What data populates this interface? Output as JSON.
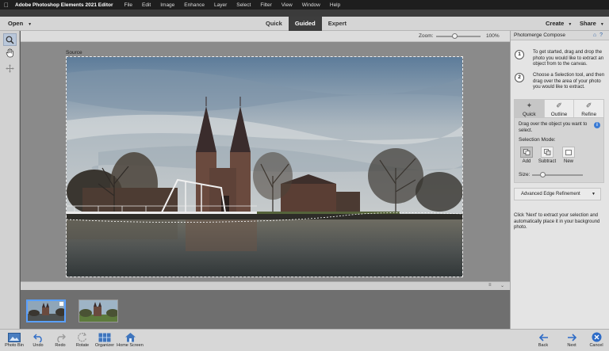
{
  "menubar": {
    "app_name": "Adobe Photoshop Elements 2021 Editor",
    "items": [
      "File",
      "Edit",
      "Image",
      "Enhance",
      "Layer",
      "Select",
      "Filter",
      "View",
      "Window",
      "Help"
    ]
  },
  "modebar": {
    "open_label": "Open",
    "tabs": [
      {
        "label": "Quick",
        "active": false
      },
      {
        "label": "Guided",
        "active": true
      },
      {
        "label": "Expert",
        "active": false
      }
    ],
    "create_label": "Create",
    "share_label": "Share"
  },
  "tools": [
    "zoom-icon",
    "hand-icon",
    "move-icon"
  ],
  "canvas": {
    "zoom_label": "Zoom:",
    "zoom_value": "100%",
    "zoom_level_percent": 100,
    "source_label": "Source"
  },
  "panel": {
    "title": "Photomerge Compose",
    "steps": [
      {
        "number": "1",
        "text": "To get started, drag and drop the photo you would like to extract an object from to the canvas."
      },
      {
        "number": "2",
        "text": "Choose a Selection tool, and then drag over the area of your photo you would like to extract."
      }
    ],
    "modes": [
      {
        "label": "Quick",
        "icon": "quick-selection-icon",
        "active": true
      },
      {
        "label": "Outline",
        "icon": "outline-brush-icon",
        "active": false
      },
      {
        "label": "Refine",
        "icon": "refine-brush-icon",
        "active": false
      }
    ],
    "hint": "Drag over the object you want to select.",
    "selection_mode_label": "Selection Mode:",
    "selection_modes": [
      {
        "label": "Add",
        "active": true
      },
      {
        "label": "Subtract",
        "active": false
      },
      {
        "label": "New",
        "active": false
      }
    ],
    "size_label": "Size:",
    "advanced_edge_label": "Advanced Edge Refinement",
    "next_hint": "Click 'Next' to extract your selection and automatically place it in your background photo."
  },
  "bin_thumbnails": [
    "delft-water-photo",
    "delft-grass-photo"
  ],
  "taskbar": {
    "photo_bin": "Photo Bin",
    "undo": "Undo",
    "redo": "Redo",
    "rotate": "Rotate",
    "organizer": "Organizer",
    "home_screen": "Home Screen",
    "back": "Back",
    "next": "Next",
    "cancel": "Cancel"
  },
  "colors": {
    "accent": "#3a7bd5",
    "active_tab": "#3d3d3d",
    "thumb_selected": "#5aa0ff"
  }
}
